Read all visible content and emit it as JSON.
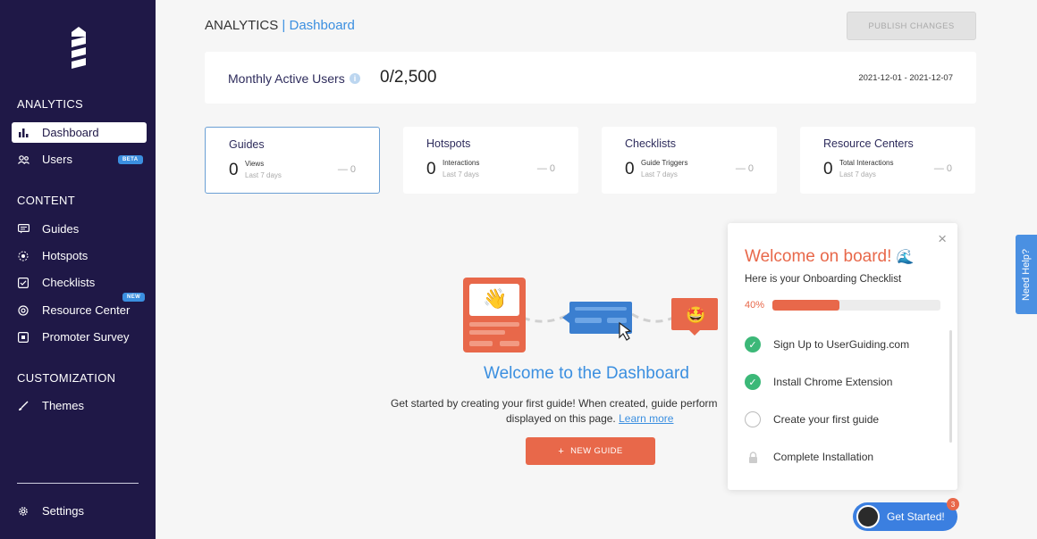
{
  "sidebar": {
    "sections": {
      "analytics": "ANALYTICS",
      "content": "CONTENT",
      "customization": "CUSTOMIZATION"
    },
    "items": {
      "dashboard": "Dashboard",
      "users": "Users",
      "users_badge": "BETA",
      "guides": "Guides",
      "hotspots": "Hotspots",
      "checklists": "Checklists",
      "resource_center": "Resource Center",
      "resource_center_badge": "NEW",
      "promoter_survey": "Promoter Survey",
      "themes": "Themes",
      "settings": "Settings"
    },
    "colors": {
      "background": "#1f1847",
      "accent": "#3b8fe0"
    }
  },
  "header": {
    "section": "ANALYTICS",
    "separator": "|",
    "page": "Dashboard",
    "publish_button": "PUBLISH CHANGES"
  },
  "mau": {
    "label": "Monthly Active Users",
    "info_icon": "i",
    "value": "0/2,500",
    "date_range": "2021-12-01 - 2021-12-07"
  },
  "stats": [
    {
      "title": "Guides",
      "value": "0",
      "metric": "Views",
      "period": "Last 7 days",
      "delta": "— 0",
      "active": true
    },
    {
      "title": "Hotspots",
      "value": "0",
      "metric": "Interactions",
      "period": "Last 7 days",
      "delta": "— 0",
      "active": false
    },
    {
      "title": "Checklists",
      "value": "0",
      "metric": "Guide Triggers",
      "period": "Last 7 days",
      "delta": "— 0",
      "active": false
    },
    {
      "title": "Resource Centers",
      "value": "0",
      "metric": "Total Interactions",
      "period": "Last 7 days",
      "delta": "— 0",
      "active": false
    }
  ],
  "welcome": {
    "title": "Welcome to the Dashboard",
    "text_line1": "Get started by creating your first guide! When created, guide perform",
    "text_line2": "displayed on this page.",
    "learn_more": "Learn more",
    "new_guide_icon": "+",
    "new_guide_button": "NEW GUIDE",
    "illustration_emojis": {
      "wave": "👋",
      "star_eyes": "🤩"
    }
  },
  "onboarding": {
    "close_icon": "×",
    "title": "Welcome on board!",
    "title_emoji": "🌊",
    "subtitle": "Here is your Onboarding Checklist",
    "progress_label": "40%",
    "progress_value": 0.4,
    "tasks": [
      {
        "label": "Sign Up to UserGuiding.com",
        "state": "done"
      },
      {
        "label": "Install Chrome Extension",
        "state": "done"
      },
      {
        "label": "Create your first guide",
        "state": "todo"
      },
      {
        "label": "Complete Installation",
        "state": "locked"
      }
    ]
  },
  "help_tab": "Need Help?",
  "get_started": {
    "label": "Get Started!",
    "count": "3"
  }
}
